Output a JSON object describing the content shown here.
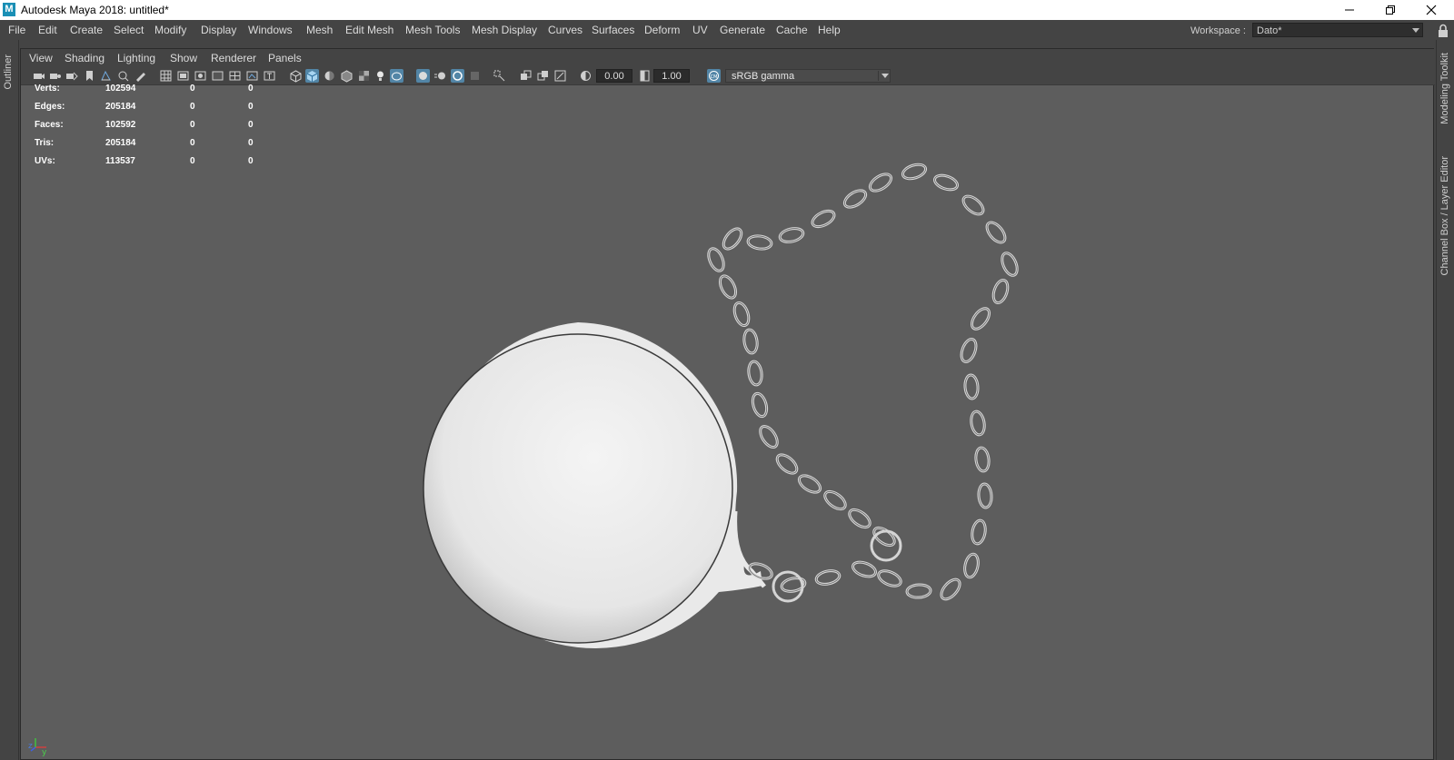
{
  "window": {
    "title": "Autodesk Maya 2018: untitled*",
    "logo_letter": "M"
  },
  "menubar": {
    "items": [
      "File",
      "Edit",
      "Create",
      "Select",
      "Modify",
      "Display",
      "Windows",
      "Mesh",
      "Edit Mesh",
      "Mesh Tools",
      "Mesh Display",
      "Curves",
      "Surfaces",
      "Deform",
      "UV",
      "Generate",
      "Cache",
      "Help"
    ],
    "workspace_label": "Workspace :",
    "workspace_value": "Dato*"
  },
  "side_panels": {
    "left": "Outliner",
    "right_top": "Modeling Toolkit",
    "right_bottom": "Channel Box / Layer Editor"
  },
  "viewport": {
    "menu": [
      "View",
      "Shading",
      "Lighting",
      "Show",
      "Renderer",
      "Panels"
    ],
    "exposure": "0.00",
    "gamma": "1.00",
    "color_space": "sRGB gamma",
    "hud": [
      {
        "label": "Verts:",
        "total": "102594",
        "selected": "0",
        "tris": "0"
      },
      {
        "label": "Edges:",
        "total": "205184",
        "selected": "0",
        "tris": "0"
      },
      {
        "label": "Faces:",
        "total": "102592",
        "selected": "0",
        "tris": "0"
      },
      {
        "label": "Tris:",
        "total": "205184",
        "selected": "0",
        "tris": "0"
      },
      {
        "label": "UVs:",
        "total": "113537",
        "selected": "0",
        "tris": "0"
      }
    ],
    "axis_labels": {
      "z": "z",
      "y": "y"
    }
  },
  "colors": {
    "viewport_bg": "#5d5d5d",
    "ui_bg": "#444444",
    "active_button": "#5285a6",
    "ball": "#ececec",
    "chain": "#d4d4d4"
  },
  "icons": [
    "window-logo-icon",
    "minimize-icon",
    "maximize-icon",
    "close-icon",
    "lock-icon",
    "camera-icon",
    "grid-icon",
    "wireframe-icon",
    "smooth-shade-icon",
    "textured-icon",
    "lights-icon",
    "isolate-icon",
    "xray-icon",
    "exposure-icon",
    "gamma-icon",
    "color-management-icon"
  ]
}
